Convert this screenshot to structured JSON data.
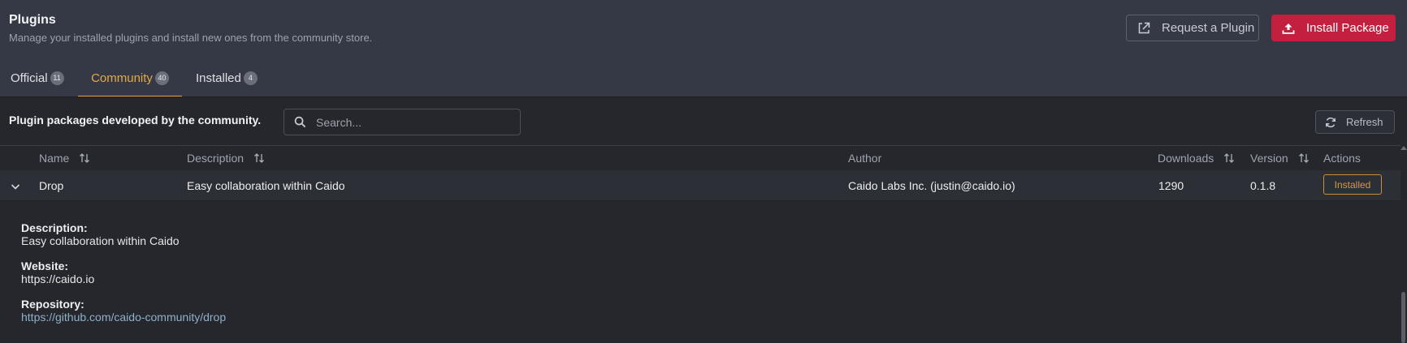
{
  "header": {
    "title": "Plugins",
    "subtitle": "Manage your installed plugins and install new ones from the community store.",
    "request_label": "Request a Plugin",
    "install_label": "Install Package"
  },
  "tabs": [
    {
      "label": "Official",
      "count": "11"
    },
    {
      "label": "Community",
      "count": "40",
      "active": true
    },
    {
      "label": "Installed",
      "count": "4"
    }
  ],
  "toolbar": {
    "caption": "Plugin packages developed by the community.",
    "search_placeholder": "Search...",
    "refresh_label": "Refresh"
  },
  "table": {
    "columns": [
      "Name",
      "Description",
      "Author",
      "Downloads",
      "Version",
      "Actions"
    ],
    "rows": [
      {
        "name": "Drop",
        "description": "Easy collaboration within Caido",
        "author": "Caido Labs Inc. (justin@caido.io)",
        "downloads": "1290",
        "version": "0.1.8",
        "action": "Installed",
        "expanded": true
      }
    ]
  },
  "detail": {
    "description_label": "Description:",
    "description": "Easy collaboration within Caido",
    "website_label": "Website:",
    "website": "https://caido.io",
    "repository_label": "Repository:",
    "repository": "https://github.com/caido-community/drop"
  },
  "colors": {
    "accent": "#e3a84b",
    "primary_button": "#c3203f",
    "link": "#8fb0c8"
  }
}
